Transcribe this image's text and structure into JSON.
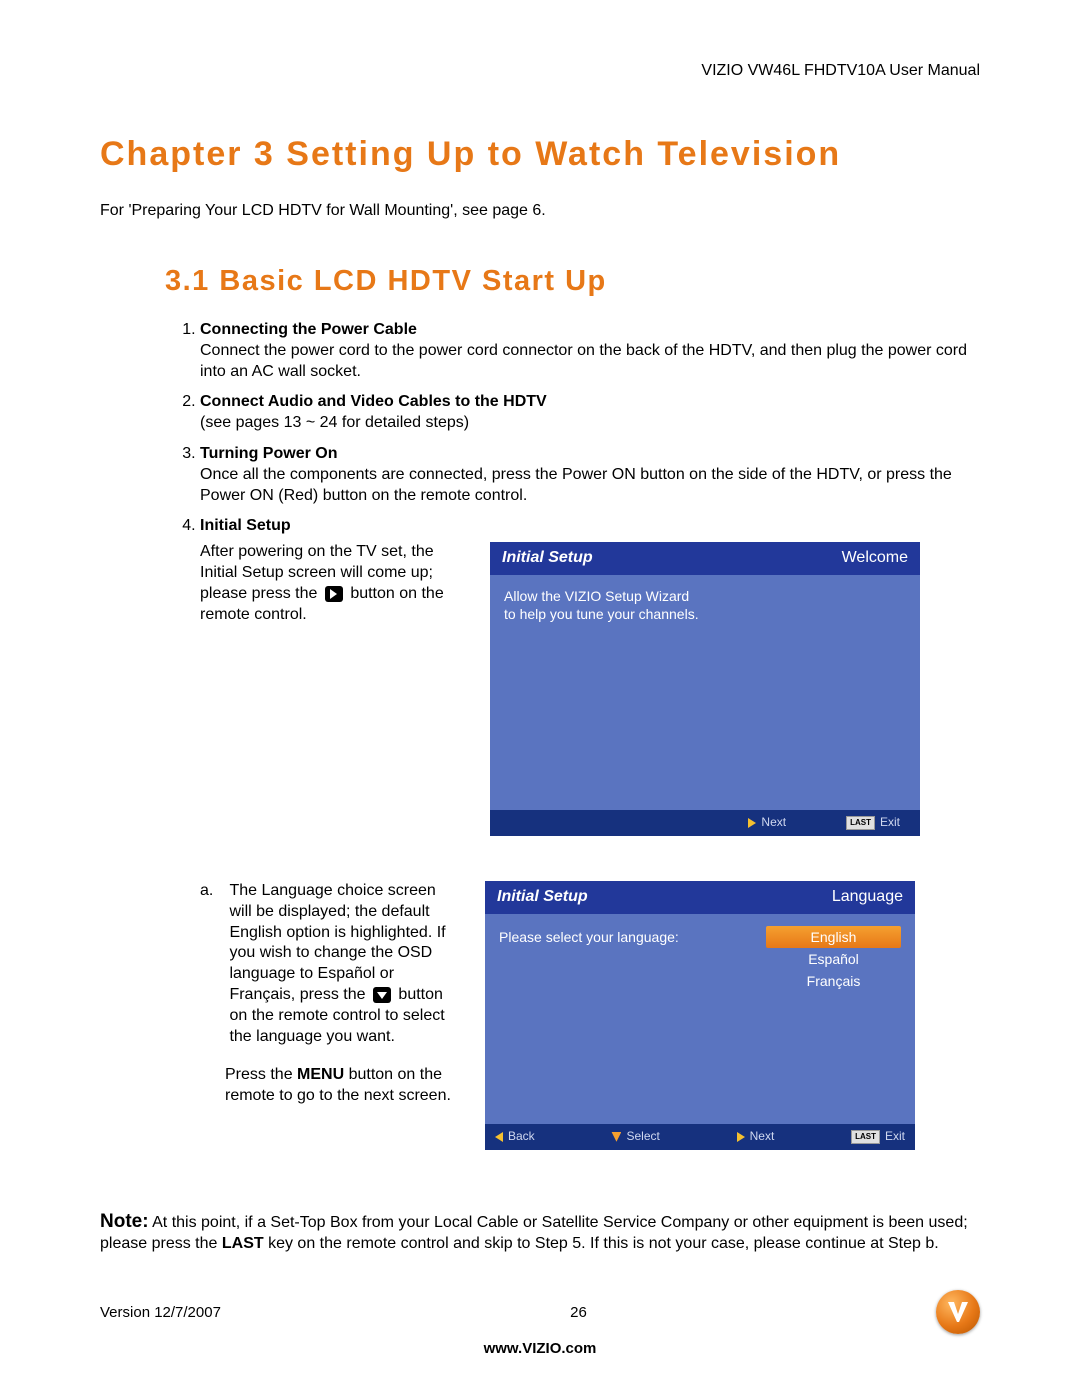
{
  "header": {
    "manual_title": "VIZIO VW46L FHDTV10A User Manual"
  },
  "chapter": {
    "title": "Chapter 3  Setting Up to Watch Television",
    "intro": "For 'Preparing Your LCD HDTV for Wall Mounting', see page 6."
  },
  "section": {
    "title": "3.1 Basic LCD HDTV Start Up"
  },
  "steps": [
    {
      "title": "Connecting the Power Cable",
      "body": "Connect the power cord to the power cord connector on the back of the HDTV, and then plug the power cord into an AC wall socket."
    },
    {
      "title": "Connect Audio and Video Cables to the HDTV",
      "body": "(see pages 13 ~ 24 for detailed steps)"
    },
    {
      "title": "Turning Power On",
      "body": "Once all the components are connected, press the Power ON button on the side of the HDTV, or press the Power ON (Red) button on the remote control."
    },
    {
      "title": "Initial Setup",
      "body_before_icon": "After powering on the TV set, the Initial Setup screen will come up; please press the",
      "body_after_icon": "button on the remote control."
    }
  ],
  "osd1": {
    "header_left": "Initial  Setup",
    "header_right": "Welcome",
    "line1": "Allow the VIZIO Setup Wizard",
    "line2": "to help you tune your channels.",
    "footer_next": "Next",
    "footer_exit": "Exit",
    "footer_last_badge": "LAST"
  },
  "sub_a": {
    "label": "a.",
    "text_before": "The Language choice screen will be displayed; the default English option is highlighted.  If you wish to change the OSD language to Español or Français, press the",
    "text_after": "button on the remote control to select the language you want.",
    "para2_before": "Press the ",
    "para2_bold": "MENU",
    "para2_after": " button on the remote to go to the next screen."
  },
  "osd2": {
    "header_left": "Initial  Setup",
    "header_right": "Language",
    "prompt": "Please select your language:",
    "options": [
      "English",
      "Español",
      "Français"
    ],
    "footer_back": "Back",
    "footer_select": "Select",
    "footer_next": "Next",
    "footer_exit": "Exit",
    "footer_last_badge": "LAST"
  },
  "note": {
    "label": "Note:",
    "body_before": "At this point, if a Set-Top Box from your Local Cable or Satellite Service Company or other equipment is been used; please press the ",
    "body_bold": "LAST",
    "body_after": " key on the remote control and skip to Step 5. If this is not your case, please continue at Step b."
  },
  "footer": {
    "version": "Version 12/7/2007",
    "page": "26",
    "url": "www.VIZIO.com"
  }
}
